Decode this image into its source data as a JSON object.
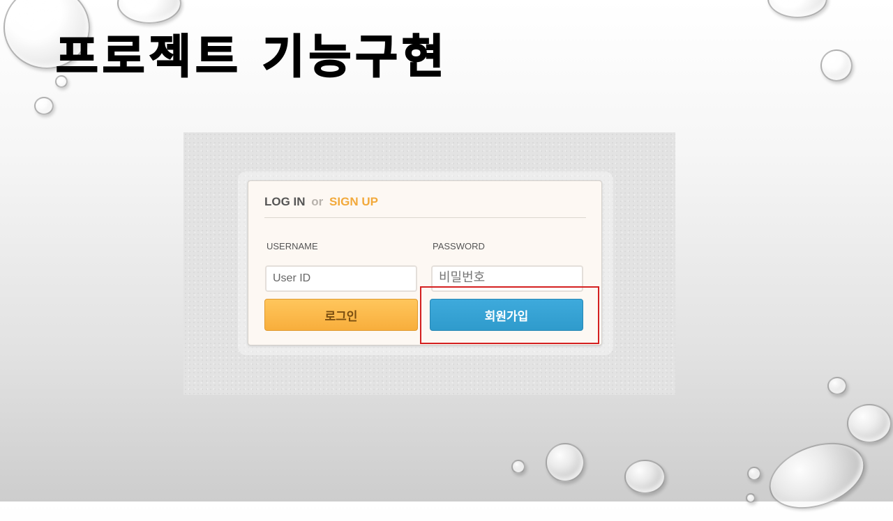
{
  "slide": {
    "title": "프로젝트 기능구현"
  },
  "login_form": {
    "header": {
      "login": "LOG IN",
      "or": "or",
      "signup": "SIGN UP"
    },
    "username_label": "USERNAME",
    "password_label": "PASSWORD",
    "username_value": "User ID",
    "password_placeholder": "비밀번호",
    "login_button": "로그인",
    "signup_button": "회원가입"
  },
  "colors": {
    "signup_accent": "#f2a93b",
    "login_button": "#f8ae3c",
    "signup_button": "#2f9bcc",
    "highlight": "#d42020"
  }
}
